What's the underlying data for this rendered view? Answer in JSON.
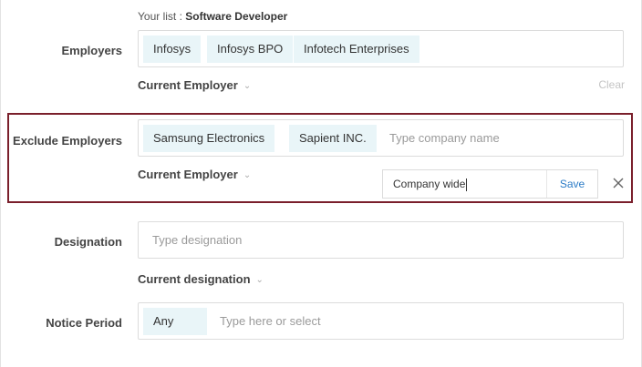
{
  "your_list": {
    "prefix": "Your list :",
    "value": "Software Developer"
  },
  "employers": {
    "label": "Employers",
    "tags": [
      "Infosys",
      "Infosys BPO",
      "Infotech Enterprises"
    ],
    "dropdown_label": "Current Employer",
    "clear_label": "Clear"
  },
  "exclude_employers": {
    "label": "Exclude Employers",
    "tags": [
      "Samsung Electronics",
      "Sapient INC."
    ],
    "placeholder": "Type company name",
    "dropdown_label": "Current Employer",
    "popup": {
      "value": "Company wide",
      "save_label": "Save"
    }
  },
  "designation": {
    "label": "Designation",
    "placeholder": "Type designation",
    "dropdown_label": "Current designation"
  },
  "notice_period": {
    "label": "Notice Period",
    "tags": [
      "Any"
    ],
    "placeholder": "Type here or select"
  },
  "colors": {
    "tag_bg": "#e9f5f8",
    "highlight_border": "#7a1f2b",
    "save_link": "#2b7bc6"
  },
  "icons": {
    "dropdown": "chevron-down-icon",
    "close": "close-icon"
  }
}
